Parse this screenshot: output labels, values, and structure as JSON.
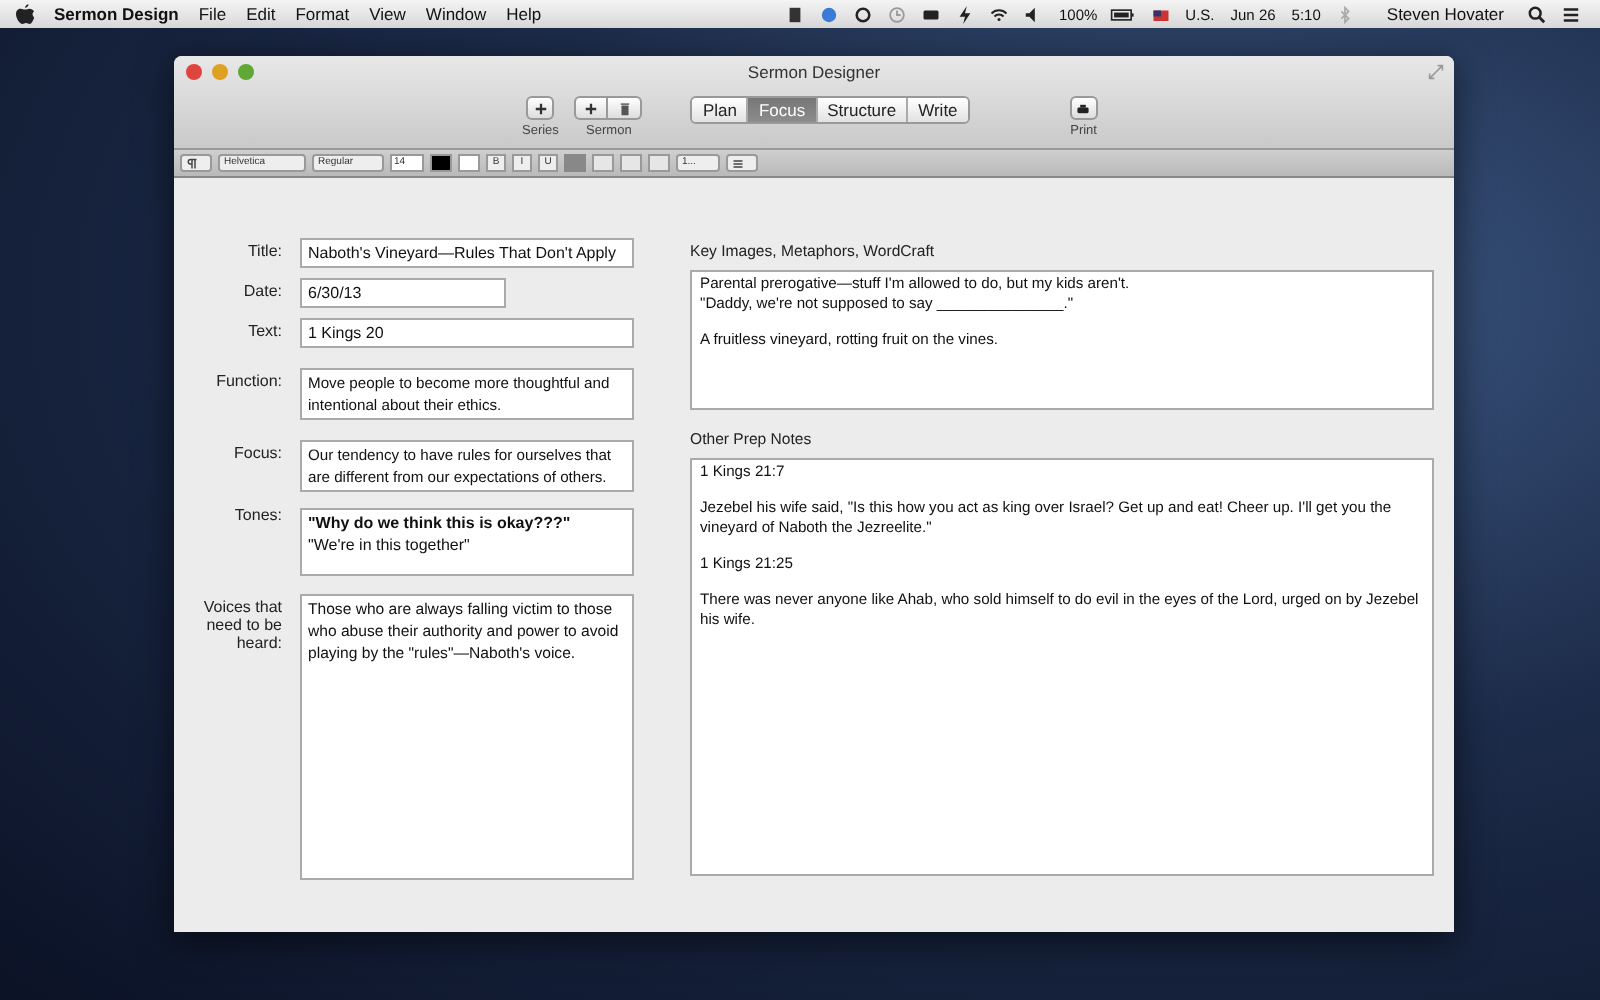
{
  "menubar": {
    "app": "Sermon Design",
    "menus": [
      "File",
      "Edit",
      "Format",
      "View",
      "Window",
      "Help"
    ],
    "battery": "100%",
    "input_source": "U.S.",
    "date": "Jun 26",
    "time": "5:10",
    "user": "Steven Hovater"
  },
  "window": {
    "title": "Sermon Designer"
  },
  "toolbar": {
    "series_label": "Series",
    "sermon_label": "Sermon",
    "print_label": "Print",
    "tabs": [
      {
        "label": "Plan",
        "selected": false
      },
      {
        "label": "Focus",
        "selected": true
      },
      {
        "label": "Structure",
        "selected": false
      },
      {
        "label": "Write",
        "selected": false
      }
    ]
  },
  "format_bar": {
    "font": "Helvetica",
    "style": "Regular",
    "size": "14",
    "bold": "B",
    "italic": "I",
    "underline": "U",
    "spacing": "1..."
  },
  "fields": [
    {
      "label": "Title:",
      "kind": "line",
      "value": "Naboth's Vineyard—Rules That Don't Apply"
    },
    {
      "label": "Date:",
      "kind": "short",
      "value": "6/30/13"
    },
    {
      "label": "Text:",
      "kind": "line",
      "value": "1 Kings 20"
    },
    {
      "label": "Function:",
      "kind": "box",
      "lines": [
        "Move people to become more thoughtful and intentional about their ethics."
      ]
    },
    {
      "label": "Focus:",
      "kind": "box",
      "lines": [
        "Our tendency to have rules for ourselves that are different from our expectations of others."
      ]
    },
    {
      "label": "Tones:",
      "kind": "rich",
      "lines": [
        "**\"Why do we think this is okay???\"**",
        "\"We're in this together\""
      ]
    },
    {
      "label": "Voices that need to be heard:",
      "kind": "large",
      "lines": [
        "Those who are always falling victim to those who abuse their authority and power to avoid playing by the \"rules\"—Naboth's voice."
      ]
    }
  ],
  "notes": [
    {
      "heading": "Key Images, Metaphors, WordCraft",
      "paragraphs": [
        [
          "Parental prerogative—stuff I'm allowed to do, but my kids aren't.",
          "\"Daddy, we're not supposed to say _______________.\""
        ],
        [
          "A fruitless vineyard, rotting fruit on the vines."
        ]
      ]
    },
    {
      "heading": "Other Prep Notes",
      "paragraphs": [
        [
          "1 Kings 21:7"
        ],
        [
          "Jezebel his wife said, \"Is this how you act as king over Israel? Get up and eat! Cheer up. I'll get you the vineyard of Naboth the Jezreelite.\""
        ],
        [
          "1 Kings 21:25"
        ],
        [
          "There was never anyone like Ahab, who sold himself to do evil in the eyes of the Lord, urged on by Jezebel his wife."
        ]
      ]
    }
  ]
}
